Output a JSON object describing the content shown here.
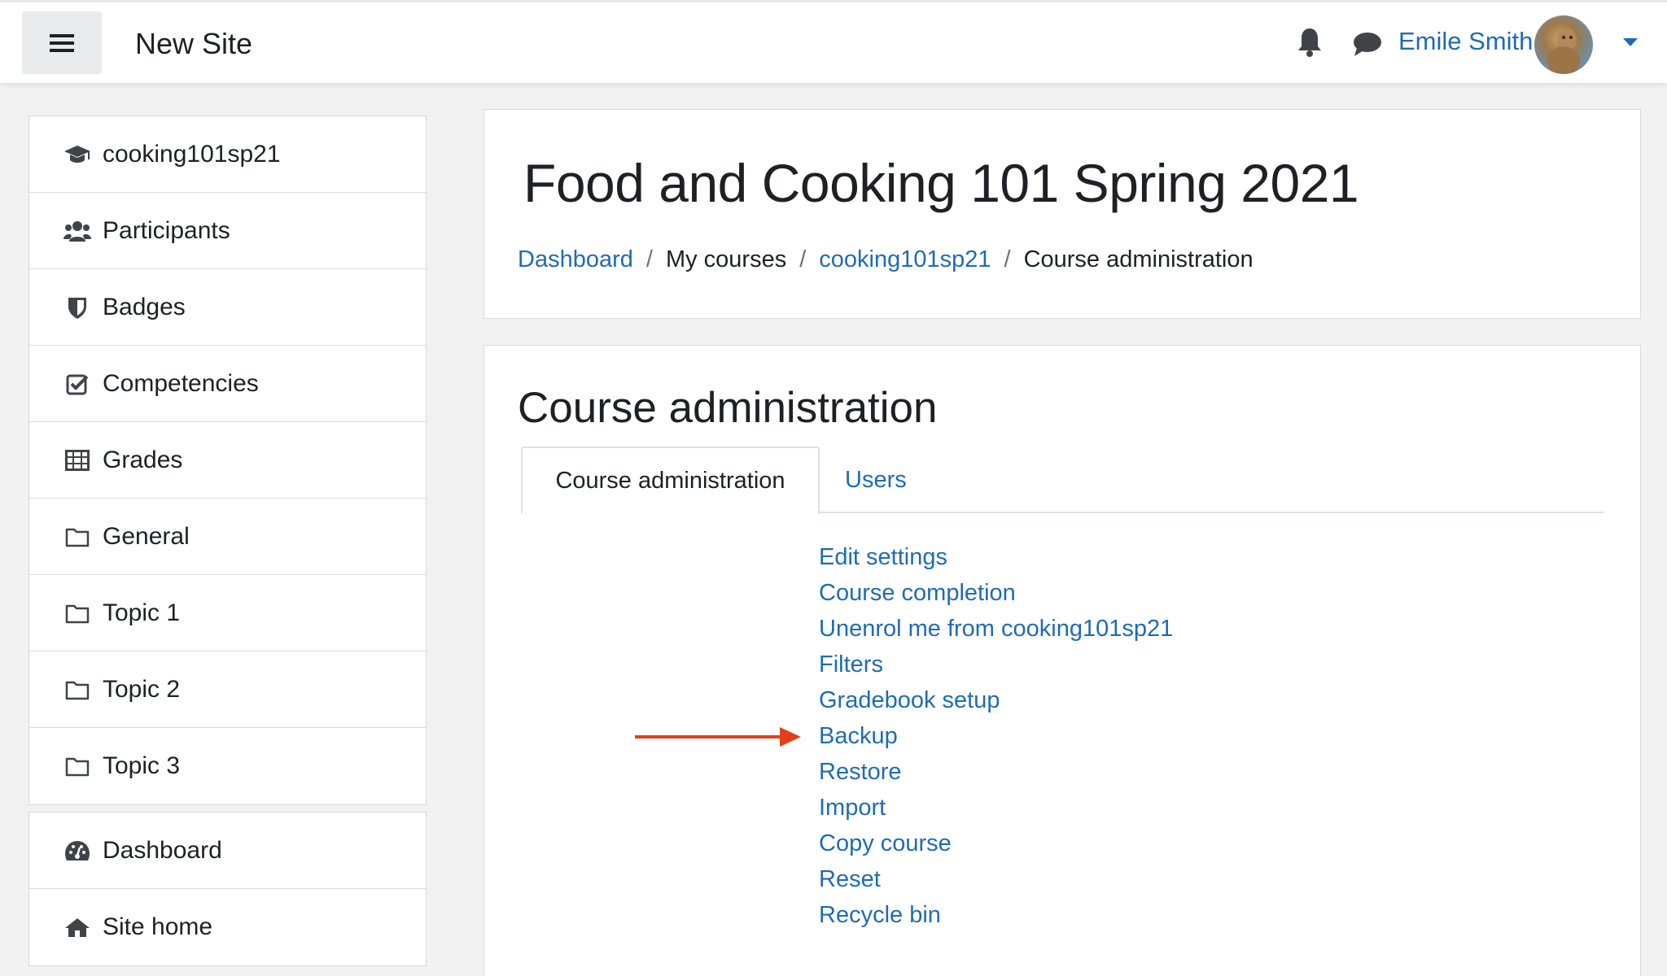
{
  "navbar": {
    "site_name": "New Site",
    "user_name": "Emile Smith",
    "icons": [
      "bars-icon",
      "bell-icon",
      "chat-icon",
      "avatar",
      "caret-down-icon"
    ]
  },
  "sidebar": {
    "course_items": [
      {
        "label": "cooking101sp21",
        "icon": "graduation-cap-icon"
      },
      {
        "label": "Participants",
        "icon": "users-icon"
      },
      {
        "label": "Badges",
        "icon": "shield-icon"
      },
      {
        "label": "Competencies",
        "icon": "check-square-icon"
      },
      {
        "label": "Grades",
        "icon": "table-icon"
      },
      {
        "label": "General",
        "icon": "folder-icon"
      },
      {
        "label": "Topic 1",
        "icon": "folder-icon"
      },
      {
        "label": "Topic 2",
        "icon": "folder-icon"
      },
      {
        "label": "Topic 3",
        "icon": "folder-icon"
      }
    ],
    "site_items": [
      {
        "label": "Dashboard",
        "icon": "dashboard-icon"
      },
      {
        "label": "Site home",
        "icon": "home-icon"
      }
    ]
  },
  "header": {
    "title": "Food and Cooking 101 Spring 2021",
    "breadcrumb": [
      {
        "label": "Dashboard",
        "link": true
      },
      {
        "label": "My courses",
        "link": false
      },
      {
        "label": "cooking101sp21",
        "link": true
      },
      {
        "label": "Course administration",
        "link": false
      }
    ]
  },
  "admin": {
    "title": "Course administration",
    "tabs": [
      {
        "label": "Course administration",
        "active": true
      },
      {
        "label": "Users",
        "active": false
      }
    ],
    "links": [
      "Edit settings",
      "Course completion",
      "Unenrol me from cooking101sp21",
      "Filters",
      "Gradebook setup",
      "Backup",
      "Restore",
      "Import",
      "Copy course",
      "Reset",
      "Recycle bin"
    ],
    "highlighted_link": "Backup",
    "arrow_color": "#e2401c"
  },
  "colors": {
    "link": "#1f6bb5",
    "text": "#1d2125",
    "page_bg": "#f2f2f2",
    "toggle_bg": "#e9eaec"
  }
}
